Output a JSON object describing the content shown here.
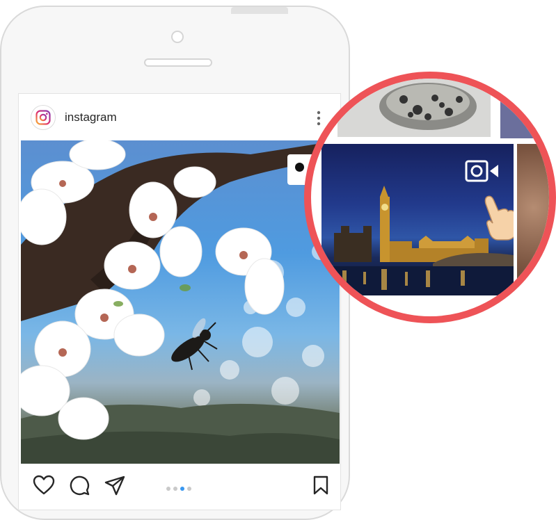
{
  "post": {
    "username": "instagram",
    "carousel": {
      "total": 4,
      "active_index": 2
    }
  },
  "icons": {
    "logo": "instagram-logo-icon",
    "more": "more-vertical-icon",
    "video_badge": "video-badge-icon",
    "like": "heart-icon",
    "comment": "comment-icon",
    "share": "paper-plane-icon",
    "save": "bookmark-icon",
    "zoom_video": "video-camera-icon",
    "pointer": "pointing-hand-icon"
  },
  "colors": {
    "zoom_ring": "#ee5357",
    "active_dot": "#3897f0",
    "text": "#262626"
  }
}
